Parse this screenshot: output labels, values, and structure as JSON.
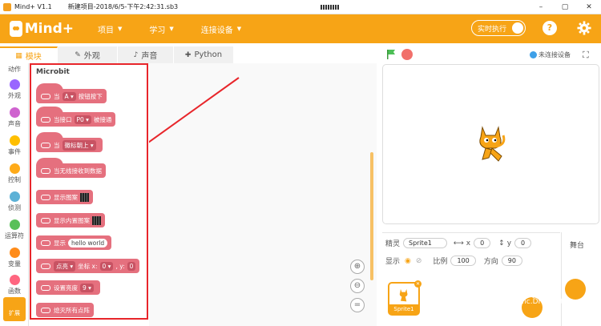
{
  "titlebar": {
    "app_title": "Mind+ V1.1",
    "project": "新建项目-2018/6/5-下午2:42:31.sb3",
    "controls": [
      "–",
      "▢",
      "✕"
    ]
  },
  "header": {
    "logo_text": "Mind+",
    "menus": [
      {
        "label": "项目"
      },
      {
        "label": "学习"
      },
      {
        "label": "连接设备"
      }
    ],
    "realtime_label": "实时执行",
    "help_label": "?"
  },
  "tabs": [
    {
      "label": "模块",
      "icon": "puzzle-icon"
    },
    {
      "label": "外观",
      "icon": "brush-icon"
    },
    {
      "label": "声音",
      "icon": "speaker-icon"
    },
    {
      "label": "Python",
      "icon": "plugin-icon"
    }
  ],
  "categories": [
    {
      "label": "动作",
      "color": ""
    },
    {
      "label": "外观",
      "color": "#9966ff"
    },
    {
      "label": "声音",
      "color": "#cf63cf"
    },
    {
      "label": "事件",
      "color": "#ffbf00"
    },
    {
      "label": "控制",
      "color": "#ffab19"
    },
    {
      "label": "侦测",
      "color": "#5cb1d6"
    },
    {
      "label": "运算符",
      "color": "#59c059"
    },
    {
      "label": "变量",
      "color": "#ff8c1a"
    },
    {
      "label": "函数",
      "color": "#ff6680"
    }
  ],
  "extension_label": "扩展",
  "palette": {
    "title": "Microbit",
    "blocks": [
      {
        "pre": "当",
        "dd": "A",
        "post": "按钮按下"
      },
      {
        "pre": "当接口",
        "dd": "P0",
        "post": "被接通"
      },
      {
        "pre": "当",
        "dd": "徽标朝上",
        "post": ""
      },
      {
        "pre": "当无线接收到数据",
        "dd": "",
        "post": ""
      },
      {
        "pre": "显示图案",
        "dd": "",
        "post": ""
      },
      {
        "pre": "显示内置图案",
        "dd": "",
        "post": ""
      },
      {
        "pre": "显示",
        "pill": "hello world"
      },
      {
        "pre": "点亮",
        "dd": "",
        "post": "坐标 x:",
        "x": "0",
        "y": "0"
      },
      {
        "pre": "设置亮度",
        "dd": "9",
        "post": ""
      },
      {
        "pre": "熄灭所有点阵",
        "dd": "",
        "post": ""
      }
    ]
  },
  "stage": {
    "device_status": "未连接设备"
  },
  "sprite_info": {
    "sprite_label": "精灵",
    "sprite_name": "Sprite1",
    "x_label": "x",
    "x_value": "0",
    "y_label": "y",
    "y_value": "0",
    "show_label": "显示",
    "size_label": "比例",
    "size_value": "100",
    "direction_label": "方向",
    "direction_value": "90",
    "thumb_label": "Sprite1"
  },
  "backdrop_label": "舞台",
  "watermark": {
    "text": "DF创客社区",
    "url": "mc.DFRobot.com.cn"
  }
}
